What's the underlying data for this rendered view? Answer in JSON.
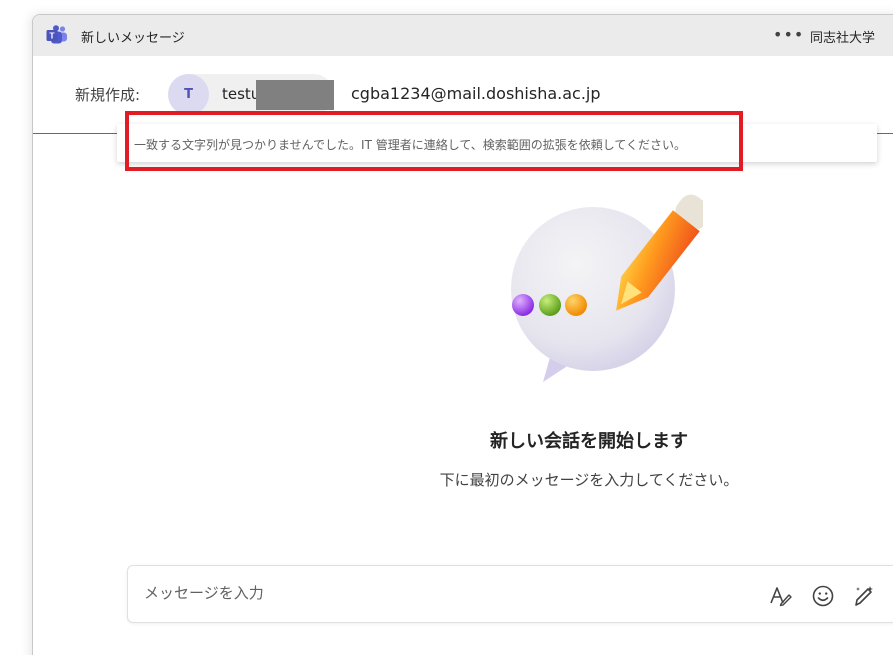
{
  "window": {
    "title": "新しいメッセージ",
    "more_label": "•••",
    "org_name": "同志社大学"
  },
  "recipient": {
    "label": "新規作成:",
    "avatar_initial": "T",
    "chip_name": "testu",
    "email": "cgba1234@mail.doshisha.ac.jp"
  },
  "error": {
    "message": "一致する文字列が見つかりませんでした。IT 管理者に連絡して、検索範囲の拡張を依頼してください。"
  },
  "empty_state": {
    "title": "新しい会話を開始します",
    "subtitle": "下に最初のメッセージを入力してください。"
  },
  "compose": {
    "placeholder": "メッセージを入力",
    "tools": [
      "format-icon",
      "emoji-icon",
      "copilot-icon"
    ]
  },
  "colors": {
    "accent": "#5b5fc7",
    "highlight": "#e21c24",
    "titlebar": "#ebebeb"
  }
}
